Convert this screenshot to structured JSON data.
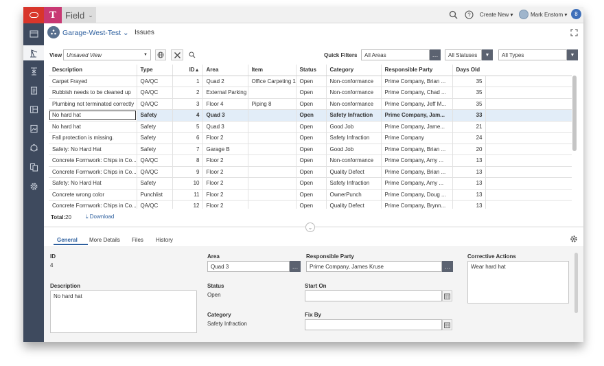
{
  "app": {
    "name": "Field",
    "icon_letter": "T"
  },
  "topbar": {
    "create_new": "Create New ▾",
    "user": "Mark Enstom ▾",
    "badge": "8"
  },
  "header": {
    "project": "Garage-West-Test",
    "section": "Issues"
  },
  "toolbar": {
    "view_label": "View",
    "view_value": "Unsaved View",
    "quick_filters_label": "Quick Filters",
    "filter_areas": "All Areas",
    "filter_statuses": "All Statuses",
    "filter_types": "All Types"
  },
  "table": {
    "columns": [
      "Description",
      "Type",
      "ID",
      "Area",
      "Item",
      "Status",
      "Category",
      "Responsible Party",
      "Days Old"
    ],
    "rows": [
      [
        "Carpet Frayed",
        "QA/QC",
        "1",
        "Quad 2",
        "Office Carpeting 1",
        "Open",
        "Non-conformance",
        "Prime Company, Brian ...",
        "35"
      ],
      [
        "Rubbish needs to be cleaned up",
        "QA/QC",
        "2",
        "External Parking",
        "",
        "Open",
        "Non-conformance",
        "Prime Company, Chad ...",
        "35"
      ],
      [
        "Plumbing not terminated correctly",
        "QA/QC",
        "3",
        "Floor 4",
        "Piping 8",
        "Open",
        "Non-conformance",
        "Prime Company, Jeff M...",
        "35"
      ],
      [
        "No hard hat",
        "Safety",
        "4",
        "Quad 3",
        "",
        "Open",
        "Safety Infraction",
        "Prime Company, Jam...",
        "33"
      ],
      [
        "No hard hat",
        "Safety",
        "5",
        "Quad 3",
        "",
        "Open",
        "Good Job",
        "Prime Company, Jame...",
        "21"
      ],
      [
        "Fall protection is missing.",
        "Safety",
        "6",
        "Floor 2",
        "",
        "Open",
        "Safety Infraction",
        "Prime Company",
        "24"
      ],
      [
        "Safety: No Hard Hat",
        "Safety",
        "7",
        "Garage B",
        "",
        "Open",
        "Good Job",
        "Prime Company, Brian ...",
        "20"
      ],
      [
        "Concrete Formwork: Chips in Co...",
        "QA/QC",
        "8",
        "Floor 2",
        "",
        "Open",
        "Non-conformance",
        "Prime Company, Amy ...",
        "13"
      ],
      [
        "Concrete Formwork: Chips in Co...",
        "QA/QC",
        "9",
        "Floor 2",
        "",
        "Open",
        "Quality Defect",
        "Prime Company, Brian ...",
        "13"
      ],
      [
        "Safety: No Hard Hat",
        "Safety",
        "10",
        "Floor 2",
        "",
        "Open",
        "Safety Infraction",
        "Prime Company, Amy ...",
        "13"
      ],
      [
        "Concrete wrong color",
        "Punchlist",
        "11",
        "Floor 2",
        "",
        "Open",
        "OwnerPunch",
        "Prime Company, Doug ...",
        "13"
      ],
      [
        "Concrete Formwork: Chips in Co...",
        "QA/QC",
        "12",
        "Floor 2",
        "",
        "Open",
        "Quality Defect",
        "Prime Company, Brynn...",
        "13"
      ]
    ],
    "selected_row": 3
  },
  "footer": {
    "total_label": "Total:",
    "total_value": "20",
    "download": "Download"
  },
  "tabs": [
    "General",
    "More Details",
    "Files",
    "History"
  ],
  "detail": {
    "id_label": "ID",
    "id_value": "4",
    "description_label": "Description",
    "description_value": "No hard hat",
    "area_label": "Area",
    "area_value": "Quad 3",
    "status_label": "Status",
    "status_value": "Open",
    "category_label": "Category",
    "category_value": "Safety Infraction",
    "responsible_label": "Responsible Party",
    "responsible_value": "Prime Company, James Kruse",
    "start_label": "Start On",
    "fix_label": "Fix By",
    "corrective_label": "Corrective Actions",
    "corrective_value": "Wear hard hat"
  },
  "colors": {
    "accent": "#2d5f9e",
    "sidebar": "#3e4a5e",
    "logo": "#d8362b",
    "app_icon": "#c83873"
  }
}
